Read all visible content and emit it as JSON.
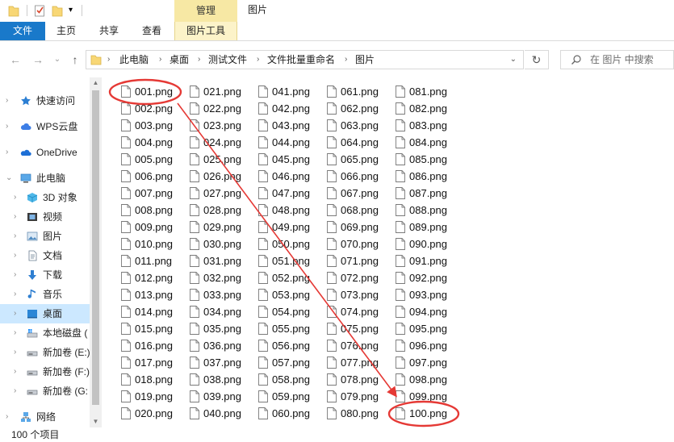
{
  "titlebar": {
    "manage_tab": "管理",
    "window_title": "图片"
  },
  "ribbon": {
    "tabs": [
      "文件",
      "主页",
      "共享",
      "查看",
      "图片工具"
    ]
  },
  "address": {
    "path": [
      "此电脑",
      "桌面",
      "测试文件",
      "文件批量重命名",
      "图片"
    ]
  },
  "search": {
    "placeholder": "在 图片 中搜索"
  },
  "sidebar": {
    "items": [
      {
        "label": "快速访问",
        "icon": "star-icon"
      },
      {
        "label": "WPS云盘",
        "icon": "cloud-icon"
      },
      {
        "label": "OneDrive",
        "icon": "onedrive-icon"
      },
      {
        "label": "此电脑",
        "icon": "computer-icon"
      },
      {
        "label": "3D 对象",
        "icon": "cube-icon"
      },
      {
        "label": "视频",
        "icon": "video-icon"
      },
      {
        "label": "图片",
        "icon": "pictures-icon"
      },
      {
        "label": "文档",
        "icon": "documents-icon"
      },
      {
        "label": "下载",
        "icon": "download-icon"
      },
      {
        "label": "音乐",
        "icon": "music-icon"
      },
      {
        "label": "桌面",
        "icon": "desktop-icon"
      },
      {
        "label": "本地磁盘 (",
        "icon": "local-disk-icon"
      },
      {
        "label": "新加卷 (E:)",
        "icon": "drive-icon"
      },
      {
        "label": "新加卷 (F:)",
        "icon": "drive-icon"
      },
      {
        "label": "新加卷 (G:",
        "icon": "drive-icon"
      },
      {
        "label": "网络",
        "icon": "network-icon"
      }
    ]
  },
  "files": {
    "names": [
      "001.png",
      "002.png",
      "003.png",
      "004.png",
      "005.png",
      "006.png",
      "007.png",
      "008.png",
      "009.png",
      "010.png",
      "011.png",
      "012.png",
      "013.png",
      "014.png",
      "015.png",
      "016.png",
      "017.png",
      "018.png",
      "019.png",
      "020.png",
      "021.png",
      "022.png",
      "023.png",
      "024.png",
      "025.png",
      "026.png",
      "027.png",
      "028.png",
      "029.png",
      "030.png",
      "031.png",
      "032.png",
      "033.png",
      "034.png",
      "035.png",
      "036.png",
      "037.png",
      "038.png",
      "039.png",
      "040.png",
      "041.png",
      "042.png",
      "043.png",
      "044.png",
      "045.png",
      "046.png",
      "047.png",
      "048.png",
      "049.png",
      "050.png",
      "051.png",
      "052.png",
      "053.png",
      "054.png",
      "055.png",
      "056.png",
      "057.png",
      "058.png",
      "059.png",
      "060.png",
      "061.png",
      "062.png",
      "063.png",
      "064.png",
      "065.png",
      "066.png",
      "067.png",
      "068.png",
      "069.png",
      "070.png",
      "071.png",
      "072.png",
      "073.png",
      "074.png",
      "075.png",
      "076.png",
      "077.png",
      "078.png",
      "079.png",
      "080.png",
      "081.png",
      "082.png",
      "083.png",
      "084.png",
      "085.png",
      "086.png",
      "087.png",
      "088.png",
      "089.png",
      "090.png",
      "091.png",
      "092.png",
      "093.png",
      "094.png",
      "095.png",
      "096.png",
      "097.png",
      "098.png",
      "099.png",
      "100.png"
    ]
  },
  "status": {
    "count": "100 个项目"
  },
  "colors": {
    "accent": "#1979ca",
    "annotation": "#e53935",
    "selection": "#cce8ff",
    "picture_tools": "#f7e8a4"
  }
}
